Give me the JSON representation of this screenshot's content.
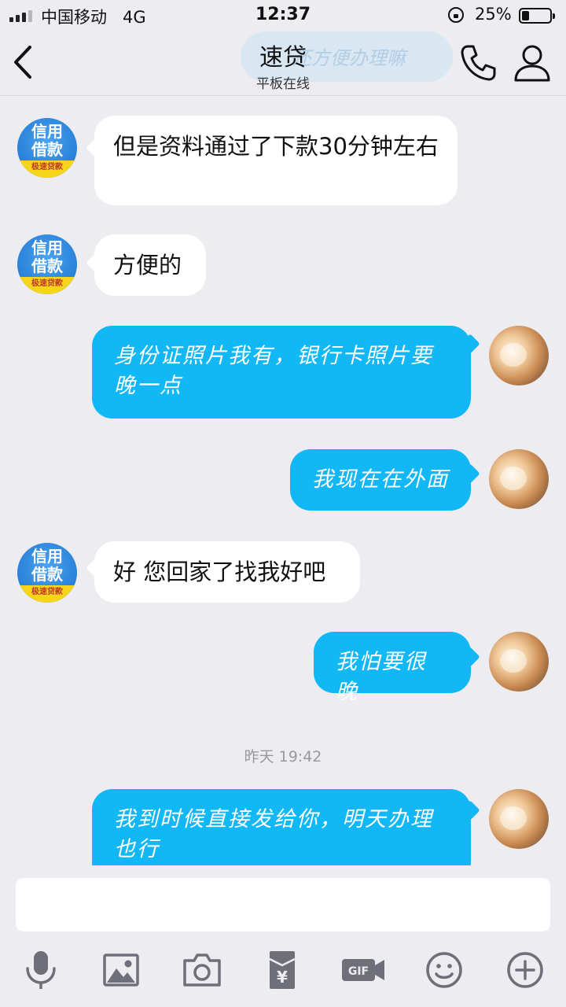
{
  "status_bar": {
    "carrier": "中国移动",
    "network": "4G",
    "time": "12:37",
    "battery_percent": "25%",
    "battery_level": 0.25,
    "signal_bars": 4,
    "icons": [
      "signal-icon",
      "orientation-lock-icon",
      "battery-icon"
    ]
  },
  "header": {
    "title": "速贷",
    "subtitle": "平板在线",
    "ghost_text": "还方便办理嘛",
    "icons": [
      "back-arrow-icon",
      "phone-icon",
      "profile-icon"
    ]
  },
  "messages": [
    {
      "side": "left",
      "avatar_line1": "信用",
      "avatar_line2": "借款",
      "avatar_tag": "极速贷款",
      "text": "但是资料通过了下款30分钟左右"
    },
    {
      "side": "left",
      "avatar_line1": "信用",
      "avatar_line2": "借款",
      "avatar_tag": "极速贷款",
      "text": "方便的"
    },
    {
      "side": "right",
      "text": "身份证照片我有，银行卡照片要晚一点"
    },
    {
      "side": "right",
      "text": "我现在在外面"
    },
    {
      "side": "left",
      "avatar_line1": "信用",
      "avatar_line2": "借款",
      "avatar_tag": "极速贷款",
      "text": "好 您回家了找我好吧"
    },
    {
      "side": "right",
      "text": "我怕要很晚"
    },
    {
      "side": "right",
      "text": "我到时候直接发给你，明天办理也行"
    }
  ],
  "timestamp": "昨天 19:42",
  "input": {
    "value": "",
    "placeholder": ""
  },
  "toolbar": {
    "icons": [
      "microphone-icon",
      "image-icon",
      "camera-icon",
      "red-packet-icon",
      "gif-icon",
      "emoji-icon",
      "plus-icon"
    ],
    "gif_label": "GIF"
  },
  "colors": {
    "accent": "#12b7f5",
    "background": "#ececf1",
    "bubble_left": "#ffffff"
  }
}
